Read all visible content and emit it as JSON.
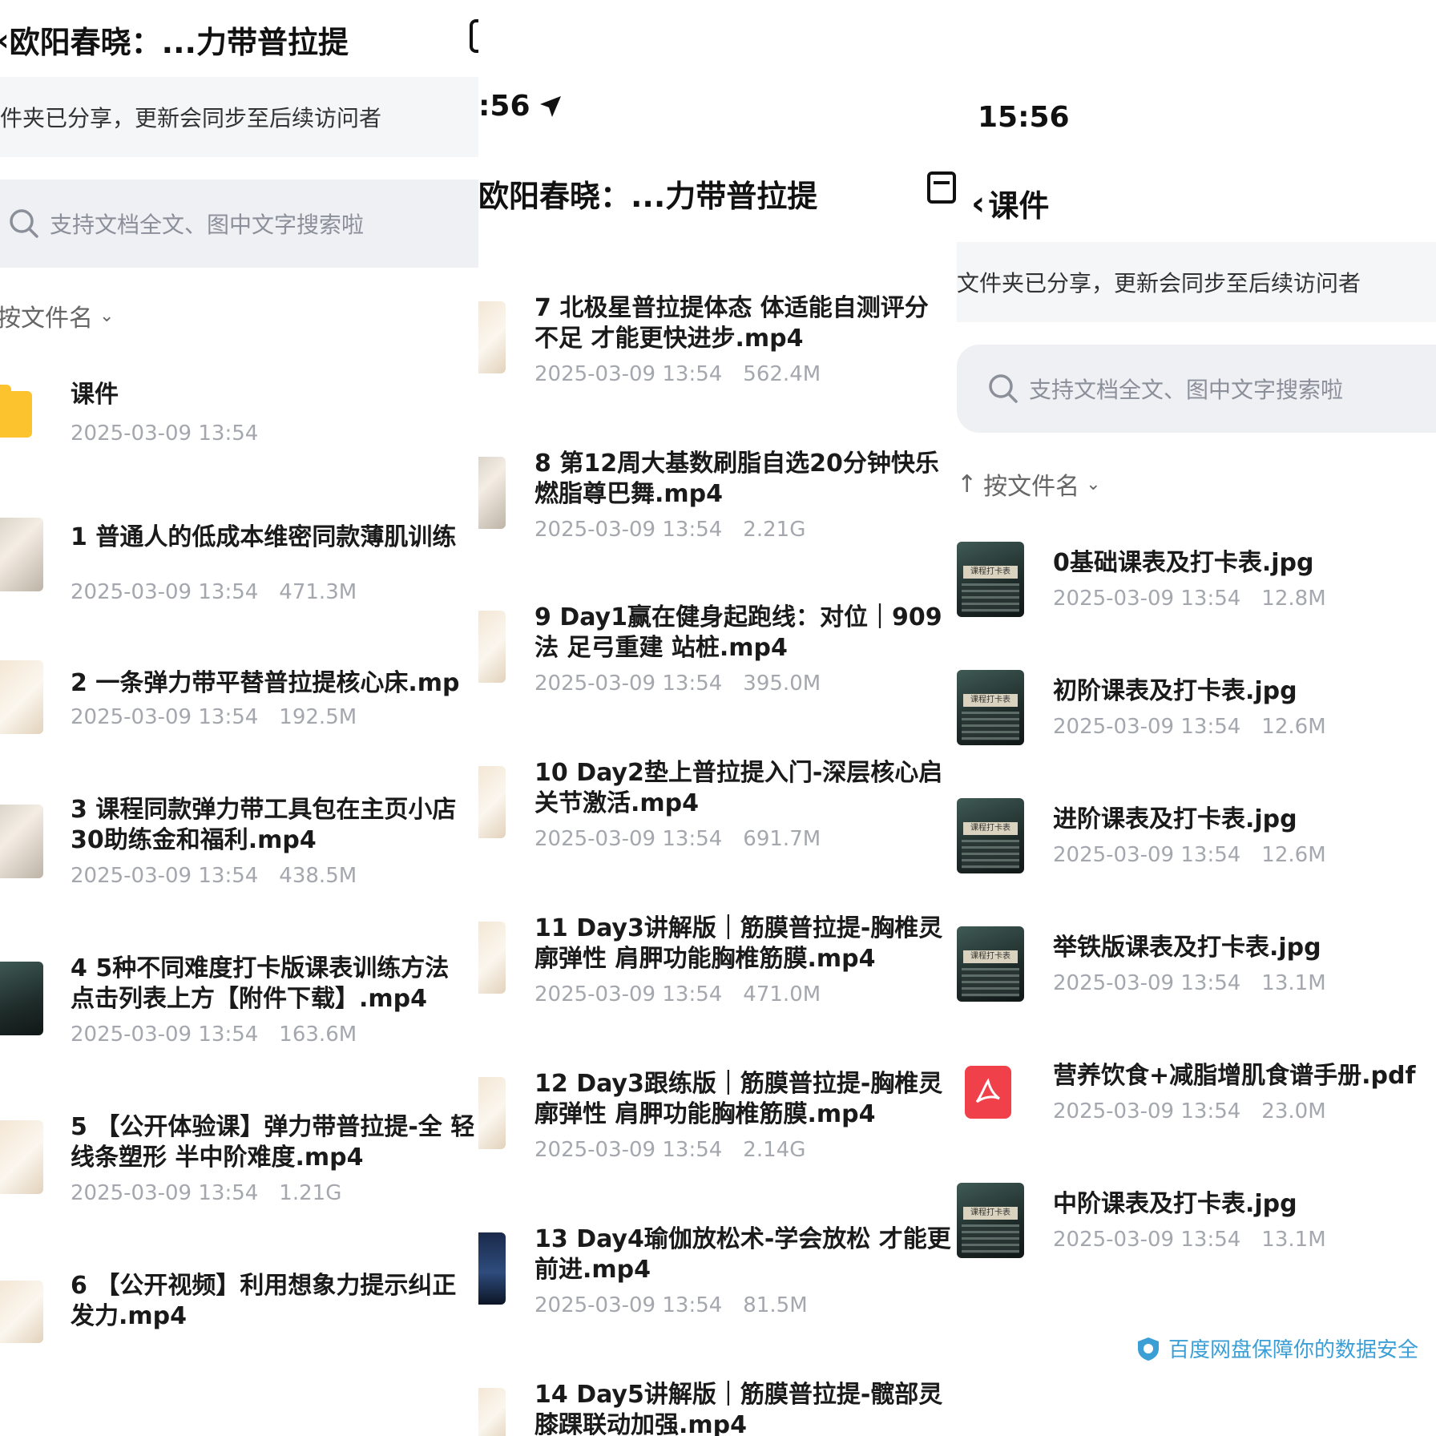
{
  "panel1": {
    "title": "欧阳春晓：...力带普拉提",
    "notice": "件夹已分享，更新会同步至后续访问者",
    "search_placeholder": "支持文档全文、图中文字搜索啦",
    "sort_label": "按文件名",
    "items": [
      {
        "name": "课件",
        "date": "2025-03-09 13:54",
        "size": ""
      },
      {
        "name": "1 普通人的低成本维密同款薄肌训练",
        "date": "2025-03-09 13:54",
        "size": "471.3M"
      },
      {
        "name": "2 一条弹力带平替普拉提核心床.mp",
        "date": "2025-03-09 13:54",
        "size": "192.5M"
      },
      {
        "name": "3 课程同款弹力带工具包在主页小店 30助练金和福利.mp4",
        "date": "2025-03-09 13:54",
        "size": "438.5M"
      },
      {
        "name": "4 5种不同难度打卡版课表训练方法 点击列表上方【附件下载】.mp4",
        "date": "2025-03-09 13:54",
        "size": "163.6M"
      },
      {
        "name": "5 【公开体验课】弹力带普拉提-全 轻线条塑形 半中阶难度.mp4",
        "date": "2025-03-09 13:54",
        "size": "1.21G"
      },
      {
        "name": "6 【公开视频】利用想象力提示纠正 发力.mp4",
        "date": "",
        "size": ""
      }
    ]
  },
  "panel2": {
    "time": ":56",
    "title": "欧阳春晓：...力带普拉提",
    "items": [
      {
        "name": "7 北极星普拉提体态 体适能自测评分 不足 才能更快进步.mp4",
        "date": "2025-03-09 13:54",
        "size": "562.4M"
      },
      {
        "name": "8 第12周大基数刷脂自选20分钟快乐 燃脂尊巴舞.mp4",
        "date": "2025-03-09 13:54",
        "size": "2.21G"
      },
      {
        "name": "9 Day1赢在健身起跑线：对位｜909 法 足弓重建 站桩.mp4",
        "date": "2025-03-09 13:54",
        "size": "395.0M"
      },
      {
        "name": "10 Day2垫上普拉提入门-深层核心启 关节激活.mp4",
        "date": "2025-03-09 13:54",
        "size": "691.7M"
      },
      {
        "name": "11 Day3讲解版｜筋膜普拉提-胸椎灵 廓弹性 肩胛功能胸椎筋膜.mp4",
        "date": "2025-03-09 13:54",
        "size": "471.0M"
      },
      {
        "name": "12 Day3跟练版｜筋膜普拉提-胸椎灵 廓弹性 肩胛功能胸椎筋膜.mp4",
        "date": "2025-03-09 13:54",
        "size": "2.14G"
      },
      {
        "name": "13 Day4瑜伽放松术-学会放松 才能更 前进.mp4",
        "date": "2025-03-09 13:54",
        "size": "81.5M"
      },
      {
        "name": "14 Day5讲解版｜筋膜普拉提-髋部灵 膝踝联动加强.mp4",
        "date": "",
        "size": ""
      }
    ]
  },
  "panel3": {
    "time": "15:56",
    "title": "课件",
    "notice": "文件夹已分享，更新会同步至后续访问者",
    "search_placeholder": "支持文档全文、图中文字搜索啦",
    "sort_label": "按文件名",
    "sort_arrow": "↑",
    "items": [
      {
        "name": "0基础课表及打卡表.jpg",
        "date": "2025-03-09 13:54",
        "size": "12.8M"
      },
      {
        "name": "初阶课表及打卡表.jpg",
        "date": "2025-03-09 13:54",
        "size": "12.6M"
      },
      {
        "name": "进阶课表及打卡表.jpg",
        "date": "2025-03-09 13:54",
        "size": "12.6M"
      },
      {
        "name": "举铁版课表及打卡表.jpg",
        "date": "2025-03-09 13:54",
        "size": "13.1M"
      },
      {
        "name": "营养饮食+减脂增肌食谱手册.pdf",
        "date": "2025-03-09 13:54",
        "size": "23.0M"
      },
      {
        "name": "中阶课表及打卡表.jpg",
        "date": "2025-03-09 13:54",
        "size": "13.1M"
      }
    ],
    "thumb_text": "课程打卡表",
    "footer": "百度网盘保障你的数据安全"
  },
  "colors": {
    "folder": "#fcc32e",
    "pdf": "#f0414a",
    "notice_bg": "#f5f6f8",
    "search_bg": "#eef0f4",
    "footer_accent": "#3b9fd6"
  },
  "icons": [
    "back-chevron-icon",
    "search-icon",
    "chevron-down-icon",
    "folder-icon",
    "location-arrow-icon",
    "share-box-icon",
    "pdf-icon",
    "shield-icon"
  ]
}
